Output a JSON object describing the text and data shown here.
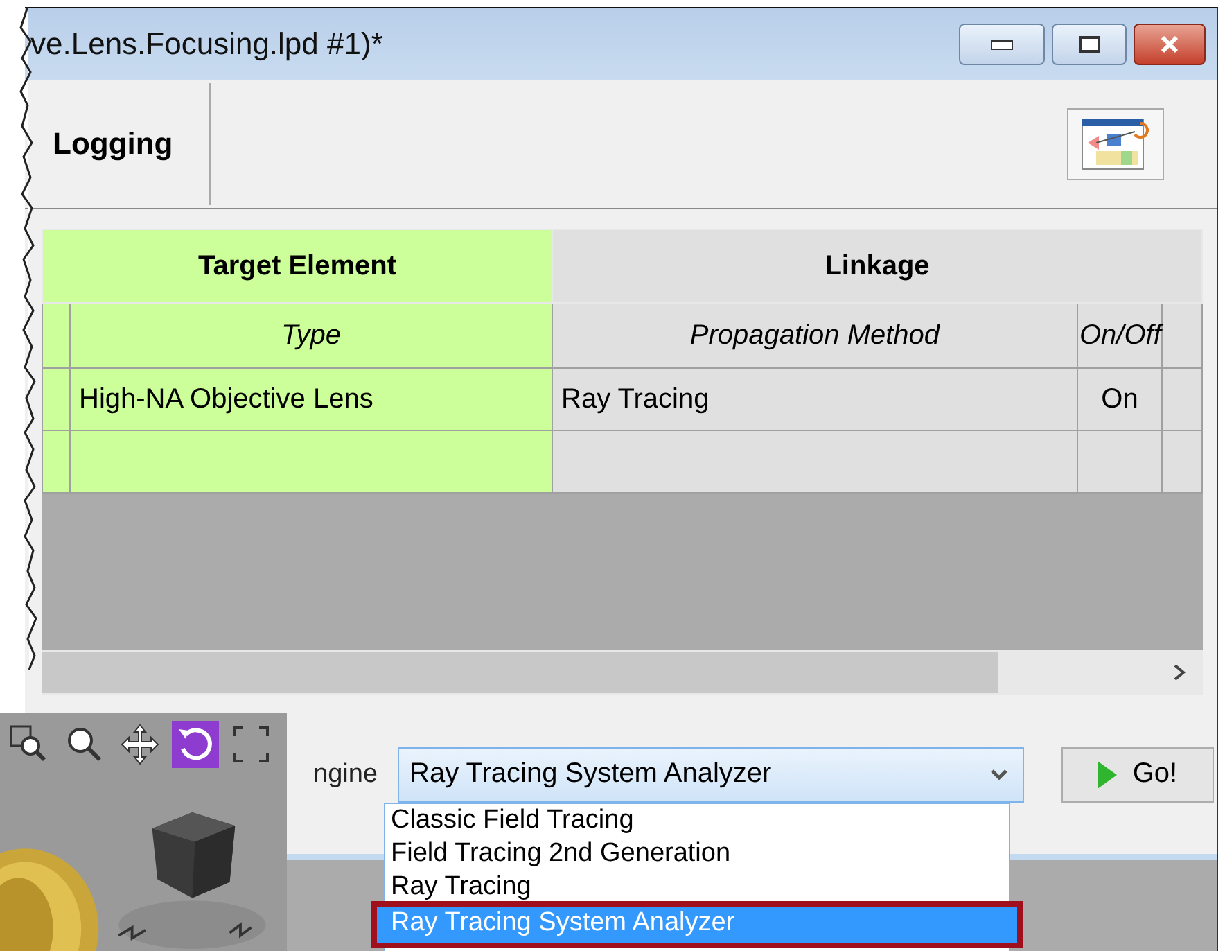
{
  "window": {
    "title": "ve.Lens.Focusing.lpd #1)*"
  },
  "toolbar": {
    "section_label": "Logging"
  },
  "table": {
    "groups": [
      {
        "label": "Target Element",
        "color": "#ccff99"
      },
      {
        "label": "Linkage",
        "color": "#e0e0e0"
      }
    ],
    "columns": [
      "Type",
      "Propagation Method",
      "On/Off"
    ],
    "rows": [
      [
        "High-NA Objective Lens",
        "Ray Tracing",
        "On"
      ]
    ]
  },
  "engine": {
    "label": "ngine",
    "value": "Ray Tracing System Analyzer",
    "options": [
      {
        "label": "Classic Field Tracing",
        "selected": false
      },
      {
        "label": "Field Tracing 2nd Generation",
        "selected": false
      },
      {
        "label": "Ray Tracing",
        "selected": false
      },
      {
        "label": "Ray Tracing System Analyzer",
        "selected": true
      }
    ]
  },
  "go_button": "Go!",
  "viewer": {
    "tools": [
      {
        "kind": "zoom-window",
        "selected": false
      },
      {
        "kind": "zoom",
        "selected": false
      },
      {
        "kind": "pan",
        "selected": false
      },
      {
        "kind": "rotate",
        "selected": true
      },
      {
        "kind": "fit",
        "selected": false
      }
    ]
  }
}
